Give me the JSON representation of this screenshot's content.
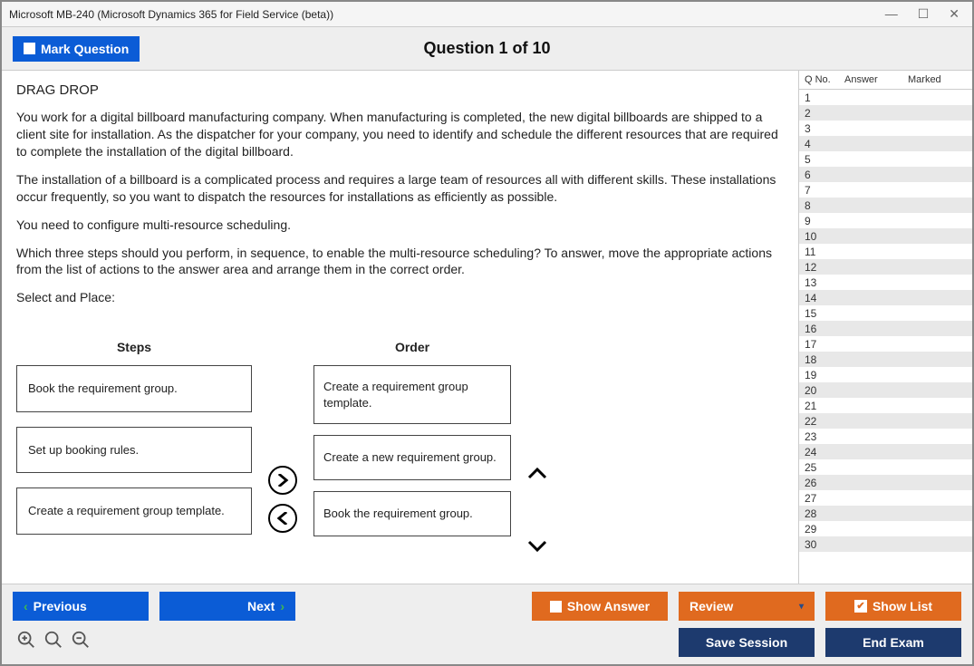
{
  "window": {
    "title": "Microsoft MB-240 (Microsoft Dynamics 365 for Field Service (beta))"
  },
  "header": {
    "mark_label": "Mark Question",
    "question_title": "Question 1 of 10"
  },
  "question": {
    "type_label": "DRAG DROP",
    "para1": "You work for a digital billboard manufacturing company. When manufacturing is completed, the new digital billboards are shipped to a client site for installation. As the dispatcher for your company, you need to identify and schedule the different resources that are required to complete the installation of the digital billboard.",
    "para2": "The installation of a billboard is a complicated process and requires a large team of resources all with different skills. These installations occur frequently, so you want to dispatch the resources for installations as efficiently as possible.",
    "para3": "You need to configure multi-resource scheduling.",
    "para4": "Which three steps should you perform, in sequence, to enable the multi-resource scheduling? To answer, move the appropriate actions from the list of actions to the answer area and arrange them in the correct order.",
    "select_label": "Select and Place:",
    "steps_header": "Steps",
    "order_header": "Order",
    "steps": [
      "Book the requirement group.",
      "Set up booking rules.",
      "Create a requirement group template."
    ],
    "order": [
      "Create a requirement group template.",
      "Create a new requirement group.",
      "Book the requirement group."
    ]
  },
  "sidepanel": {
    "col_qno": "Q No.",
    "col_answer": "Answer",
    "col_marked": "Marked",
    "rows": [
      1,
      2,
      3,
      4,
      5,
      6,
      7,
      8,
      9,
      10,
      11,
      12,
      13,
      14,
      15,
      16,
      17,
      18,
      19,
      20,
      21,
      22,
      23,
      24,
      25,
      26,
      27,
      28,
      29,
      30
    ]
  },
  "footer": {
    "previous": "Previous",
    "next": "Next",
    "show_answer": "Show Answer",
    "review": "Review",
    "show_list": "Show List",
    "save_session": "Save Session",
    "end_exam": "End Exam"
  }
}
